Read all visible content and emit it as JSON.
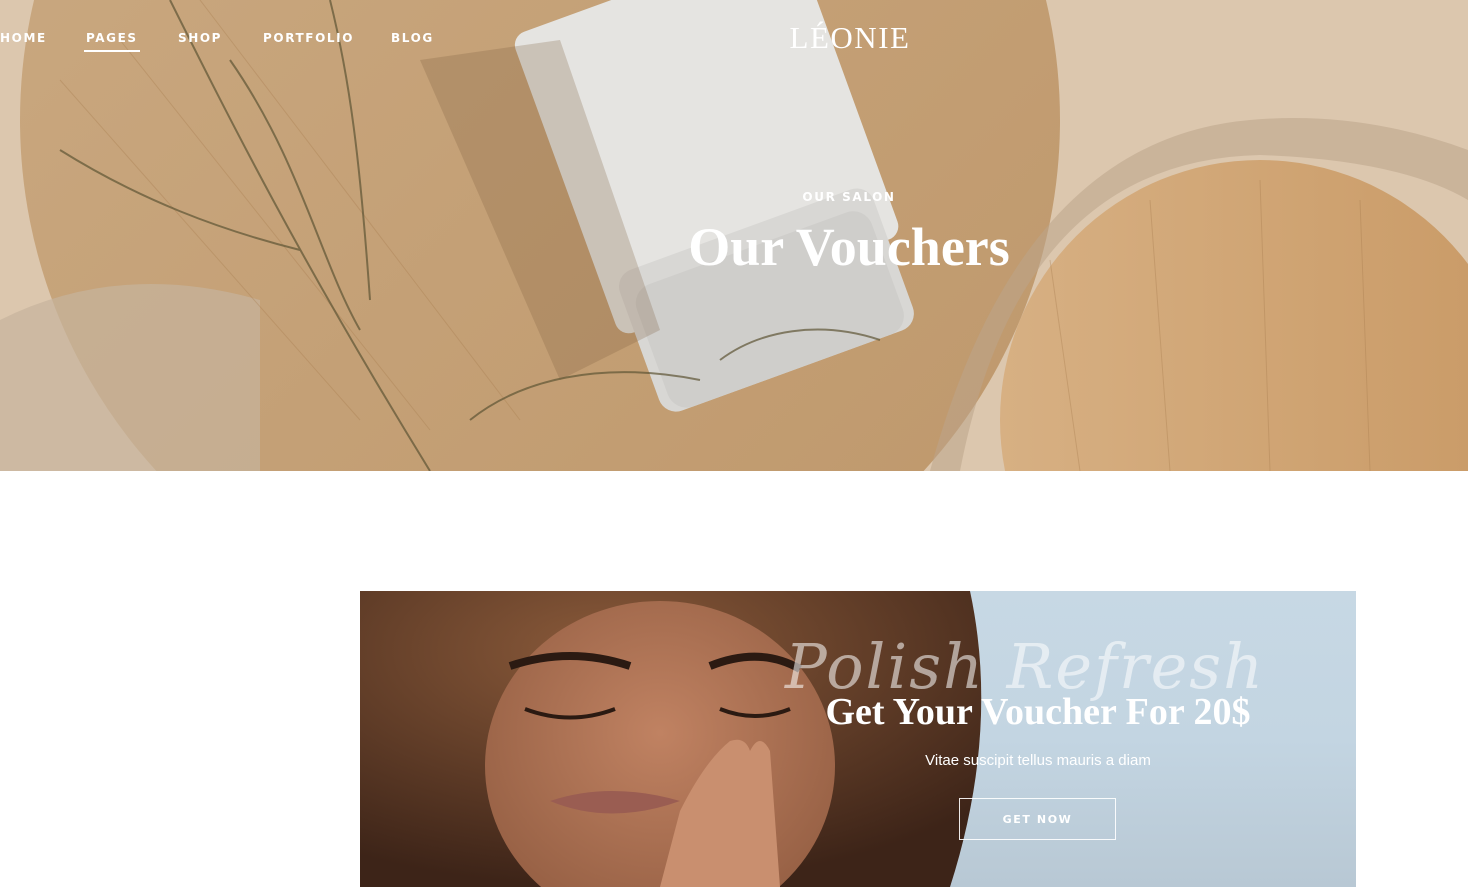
{
  "nav": {
    "items": [
      {
        "label": "HOME"
      },
      {
        "label": "PAGES",
        "active": true
      },
      {
        "label": "SHOP"
      },
      {
        "label": "PORTFOLIO"
      },
      {
        "label": "BLOG"
      }
    ]
  },
  "logo": "LÉONIE",
  "hero": {
    "eyebrow": "OUR SALON",
    "title": "Our Vouchers"
  },
  "voucher": {
    "script_text": "Polish Refresh",
    "title": "Get Your Voucher For 20$",
    "subtitle": "Vitae suscipit tellus mauris a diam",
    "button_label": "GET NOW"
  },
  "colors": {
    "text_on_image": "#ffffff",
    "banner_bg": "#c3d5e2",
    "hero_wood": "#cfb08a"
  }
}
